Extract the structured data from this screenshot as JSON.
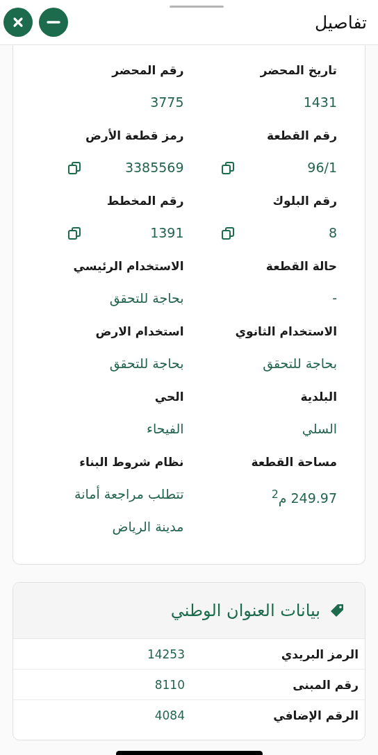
{
  "header": {
    "title": "تفاصيل"
  },
  "details": [
    {
      "label": "تاريخ المحضر",
      "value": "1431",
      "copyable": false
    },
    {
      "label": "رقم المحضر",
      "value": "3775",
      "copyable": false
    },
    {
      "label": "رقم القطعة",
      "value": "96/1",
      "copyable": true
    },
    {
      "label": "رمز قطعة الأرض",
      "value": "3385569",
      "copyable": true
    },
    {
      "label": "رقم البلوك",
      "value": "8",
      "copyable": true
    },
    {
      "label": "رقم المخطط",
      "value": "1391",
      "copyable": true
    },
    {
      "label": "حالة القطعة",
      "value": "-",
      "copyable": false
    },
    {
      "label": "الاستخدام الرئيسي",
      "value": "بحاجة للتحقق",
      "copyable": false
    },
    {
      "label": "الاستخدام الثانوي",
      "value": "بحاجة للتحقق",
      "copyable": false
    },
    {
      "label": "استخدام الارض",
      "value": "بحاجة للتحقق",
      "copyable": false
    },
    {
      "label": "البلدية",
      "value": "السلي",
      "copyable": false
    },
    {
      "label": "الحي",
      "value": "الفيحاء",
      "copyable": false
    },
    {
      "label": "مساحة القطعة",
      "value": "249.97 م$^{2}$",
      "copyable": false
    },
    {
      "label": "نظام شروط البناء",
      "value": "تتطلب مراجعة أمانة مدينة الرياض",
      "copyable": false
    }
  ],
  "address": {
    "title": "بيانات العنوان الوطني",
    "rows": [
      {
        "label": "الرمز البريدي",
        "value": "14253"
      },
      {
        "label": "رقم المبنى",
        "value": "8110"
      },
      {
        "label": "الرقم الإضافي",
        "value": "4084"
      }
    ]
  }
}
